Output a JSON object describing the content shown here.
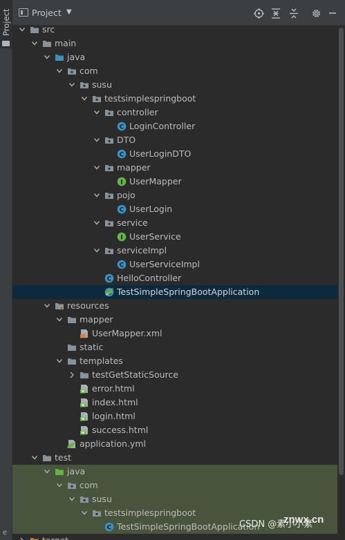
{
  "sidebar": {
    "tab_label": "Project",
    "bottom_letter": "e"
  },
  "header": {
    "title": "Project"
  },
  "tree": [
    {
      "label": "src",
      "depth": 0,
      "arrow": "down",
      "icon": "folder-plain",
      "kind": "folder-src"
    },
    {
      "label": "main",
      "depth": 1,
      "arrow": "down",
      "icon": "folder-plain",
      "kind": "folder-main"
    },
    {
      "label": "java",
      "depth": 2,
      "arrow": "down",
      "icon": "folder-source",
      "kind": "folder-java"
    },
    {
      "label": "com",
      "depth": 3,
      "arrow": "down",
      "icon": "package",
      "kind": "package-com"
    },
    {
      "label": "susu",
      "depth": 4,
      "arrow": "down",
      "icon": "package",
      "kind": "package-susu"
    },
    {
      "label": "testsimplespringboot",
      "depth": 5,
      "arrow": "down",
      "icon": "package",
      "kind": "package-testsimplespringboot"
    },
    {
      "label": "controller",
      "depth": 6,
      "arrow": "down",
      "icon": "package",
      "kind": "package-controller"
    },
    {
      "label": "LoginController",
      "depth": 7,
      "arrow": "none",
      "icon": "class",
      "kind": "class-logincontroller"
    },
    {
      "label": "DTO",
      "depth": 6,
      "arrow": "down",
      "icon": "package",
      "kind": "package-dto"
    },
    {
      "label": "UserLoginDTO",
      "depth": 7,
      "arrow": "none",
      "icon": "class",
      "kind": "class-userlogindto"
    },
    {
      "label": "mapper",
      "depth": 6,
      "arrow": "down",
      "icon": "package",
      "kind": "package-mapper"
    },
    {
      "label": "UserMapper",
      "depth": 7,
      "arrow": "none",
      "icon": "interface",
      "kind": "interface-usermapper"
    },
    {
      "label": "pojo",
      "depth": 6,
      "arrow": "down",
      "icon": "package",
      "kind": "package-pojo"
    },
    {
      "label": "UserLogin",
      "depth": 7,
      "arrow": "none",
      "icon": "class",
      "kind": "class-userlogin"
    },
    {
      "label": "service",
      "depth": 6,
      "arrow": "down",
      "icon": "package",
      "kind": "package-service"
    },
    {
      "label": "UserService",
      "depth": 7,
      "arrow": "none",
      "icon": "interface",
      "kind": "interface-userservice"
    },
    {
      "label": "serviceImpl",
      "depth": 6,
      "arrow": "down",
      "icon": "package",
      "kind": "package-serviceimpl"
    },
    {
      "label": "UserServiceImpl",
      "depth": 7,
      "arrow": "none",
      "icon": "class",
      "kind": "class-userserviceimpl"
    },
    {
      "label": "HelloController",
      "depth": 6,
      "arrow": "none",
      "icon": "class",
      "kind": "class-hellocontroller"
    },
    {
      "label": "TestSimpleSpringBootApplication",
      "depth": 6,
      "arrow": "none",
      "icon": "spring-boot-class",
      "kind": "class-testsimplespringbootapplication",
      "selected": true
    },
    {
      "label": "resources",
      "depth": 2,
      "arrow": "down",
      "icon": "folder-resources",
      "kind": "folder-resources"
    },
    {
      "label": "mapper",
      "depth": 3,
      "arrow": "down",
      "icon": "folder-plain",
      "kind": "folder-mapper"
    },
    {
      "label": "UserMapper.xml",
      "depth": 4,
      "arrow": "none",
      "icon": "xml-file",
      "kind": "file-usermapper-xml"
    },
    {
      "label": "static",
      "depth": 3,
      "arrow": "none",
      "icon": "folder-plain",
      "kind": "folder-static"
    },
    {
      "label": "templates",
      "depth": 3,
      "arrow": "down",
      "icon": "folder-plain",
      "kind": "folder-templates"
    },
    {
      "label": "testGetStaticSource",
      "depth": 4,
      "arrow": "right",
      "icon": "folder-plain",
      "kind": "folder-testgetstaticsource"
    },
    {
      "label": "error.html",
      "depth": 4,
      "arrow": "none",
      "icon": "html-file",
      "kind": "file-error-html"
    },
    {
      "label": "index.html",
      "depth": 4,
      "arrow": "none",
      "icon": "html-file",
      "kind": "file-index-html"
    },
    {
      "label": "login.html",
      "depth": 4,
      "arrow": "none",
      "icon": "html-file",
      "kind": "file-login-html"
    },
    {
      "label": "success.html",
      "depth": 4,
      "arrow": "none",
      "icon": "html-file",
      "kind": "file-success-html"
    },
    {
      "label": "application.yml",
      "depth": 3,
      "arrow": "none",
      "icon": "yml-file",
      "kind": "file-application-yml"
    },
    {
      "label": "test",
      "depth": 1,
      "arrow": "down",
      "icon": "folder-plain",
      "kind": "folder-test"
    },
    {
      "label": "java",
      "depth": 2,
      "arrow": "down",
      "icon": "folder-test-source",
      "kind": "folder-test-java",
      "test": true
    },
    {
      "label": "com",
      "depth": 3,
      "arrow": "down",
      "icon": "package",
      "kind": "package-test-com",
      "test": true
    },
    {
      "label": "susu",
      "depth": 4,
      "arrow": "down",
      "icon": "package",
      "kind": "package-test-susu",
      "test": true
    },
    {
      "label": "testsimplespringboot",
      "depth": 5,
      "arrow": "down",
      "icon": "package",
      "kind": "package-test-testsimplespringboot",
      "test": true
    },
    {
      "label": "TestSimpleSpringBootApplication",
      "depth": 6,
      "arrow": "none",
      "icon": "class",
      "kind": "class-test-testsimplespringbootapplication",
      "test": true
    },
    {
      "label": "target",
      "depth": 0,
      "arrow": "right",
      "icon": "folder-excluded",
      "kind": "folder-target"
    }
  ],
  "watermark": {
    "text": "CSDN @素小小素",
    "logo": "znwx.cn"
  },
  "colors": {
    "background": "#2b2b2b",
    "header": "#3c3f41",
    "selected_row": "#0d293e",
    "test_row": "#49543c",
    "folder": "#87939a",
    "source_folder": "#3d8ebd",
    "test_folder": "#62b543",
    "class_icon": "#3592c4",
    "interface_icon": "#62b543",
    "excluded_folder": "#cc7832"
  }
}
